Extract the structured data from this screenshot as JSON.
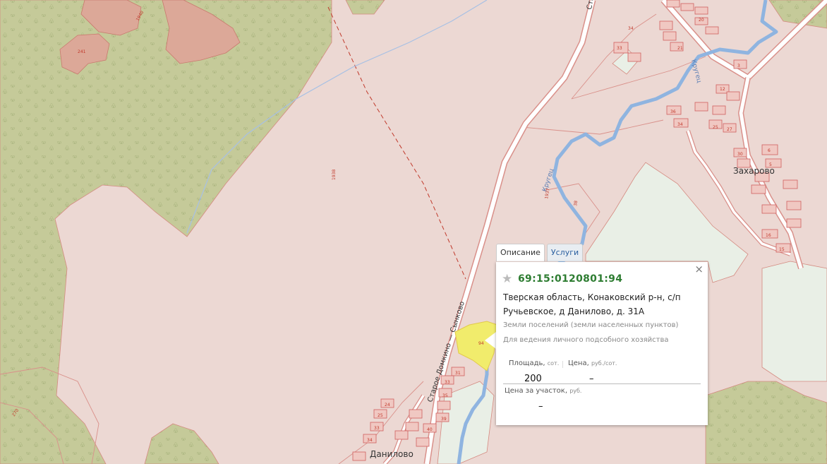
{
  "map": {
    "places": [
      {
        "id": "zakharovo",
        "label": "Захарово"
      },
      {
        "id": "danilovo",
        "label": "Данилово"
      }
    ],
    "roads": [
      {
        "id": "road-main",
        "label": "Старое Домкино — Сынково"
      },
      {
        "id": "road-north",
        "label": "Ста"
      }
    ],
    "river": {
      "label": "Кругец"
    },
    "parcel_numbers": [
      "1938",
      "1940",
      "241",
      "34",
      "33",
      "32",
      "38",
      "3",
      "12",
      "8",
      "6",
      "5",
      "16",
      "15",
      "20",
      "23",
      "21",
      "33",
      "26",
      "25",
      "27",
      "28",
      "29",
      "30",
      "31",
      "36",
      "34",
      "1",
      "2",
      "4",
      "7",
      "10",
      "11",
      "13",
      "14",
      "16",
      "17",
      "18",
      "19",
      "22",
      "27",
      "28",
      "31",
      "33",
      "35",
      "36",
      "39",
      "40",
      "94",
      "15",
      "21",
      "8",
      "49",
      "41",
      "55",
      "1937",
      "38",
      "270",
      "1",
      "19",
      "24",
      "25",
      "33",
      "34",
      "36",
      "6"
    ],
    "colors": {
      "forest": "#c7cc9b",
      "settlement": "#ecd8d3",
      "field": "#e9efe6",
      "river": "#8fb4e0",
      "selected": "#f1ec6c"
    }
  },
  "popup": {
    "tabs": [
      {
        "label": "Описание",
        "active": true
      },
      {
        "label": "Услуги",
        "active": false
      }
    ],
    "close_icon": "×",
    "star_icon": "★",
    "cadastral_number": "69:15:0120801:94",
    "address": "Тверская область, Конаковский р-н, с/п Ручьевское, д Данилово, д. 31А",
    "land_category": "Земли поселений (земли населенных пунктов)",
    "permitted_use": "Для ведения личного подсобного хозяйства",
    "area_label": "Площадь,",
    "area_unit": "сот.",
    "area_value": "200",
    "price_label": "Цена,",
    "price_unit": "руб./сот.",
    "price_value": "–",
    "price_total_label": "Цена за участок,",
    "price_total_unit": "руб.",
    "price_total_value": "–"
  }
}
